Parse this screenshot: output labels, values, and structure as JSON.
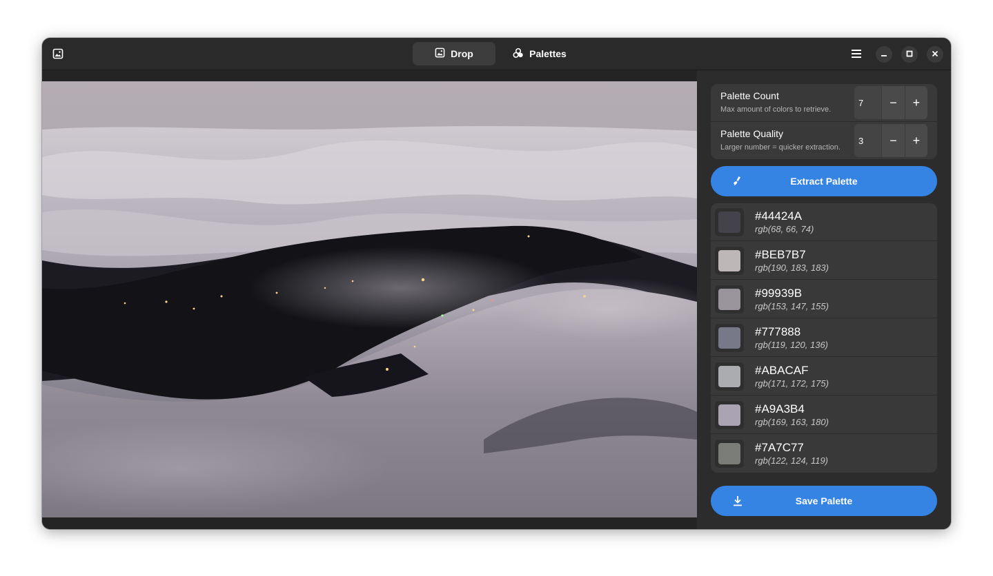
{
  "titlebar": {
    "app_icon": "image-icon",
    "tabs": [
      {
        "label": "Drop",
        "icon": "image-icon",
        "active": true
      },
      {
        "label": "Palettes",
        "icon": "palette-icon",
        "active": false
      }
    ],
    "menu_icon": "hamburger-icon",
    "window_controls": [
      "minimize-icon",
      "maximize-icon",
      "close-icon"
    ]
  },
  "image": {
    "description_icon": "photo"
  },
  "settings": {
    "palette_count": {
      "title": "Palette Count",
      "subtitle": "Max amount of colors to retrieve.",
      "value": "7",
      "minus": "−",
      "plus": "+"
    },
    "palette_quality": {
      "title": "Palette Quality",
      "subtitle": "Larger number = quicker extraction.",
      "value": "3",
      "minus": "−",
      "plus": "+"
    }
  },
  "extract_button": {
    "label": "Extract Palette",
    "icon": "brush-icon"
  },
  "colors": [
    {
      "hex": "#44424A",
      "rgb": "rgb(68, 66, 74)",
      "swatch": "#44424A"
    },
    {
      "hex": "#BEB7B7",
      "rgb": "rgb(190, 183, 183)",
      "swatch": "#BEB7B7"
    },
    {
      "hex": "#99939B",
      "rgb": "rgb(153, 147, 155)",
      "swatch": "#99939B"
    },
    {
      "hex": "#777888",
      "rgb": "rgb(119, 120, 136)",
      "swatch": "#777888"
    },
    {
      "hex": "#ABACAF",
      "rgb": "rgb(171, 172, 175)",
      "swatch": "#ABACAF"
    },
    {
      "hex": "#A9A3B4",
      "rgb": "rgb(169, 163, 180)",
      "swatch": "#A9A3B4"
    },
    {
      "hex": "#7A7C77",
      "rgb": "rgb(122, 124, 119)",
      "swatch": "#7A7C77"
    }
  ],
  "save_button": {
    "label": "Save Palette",
    "icon": "download-icon"
  },
  "accent_color": "#3584e4"
}
